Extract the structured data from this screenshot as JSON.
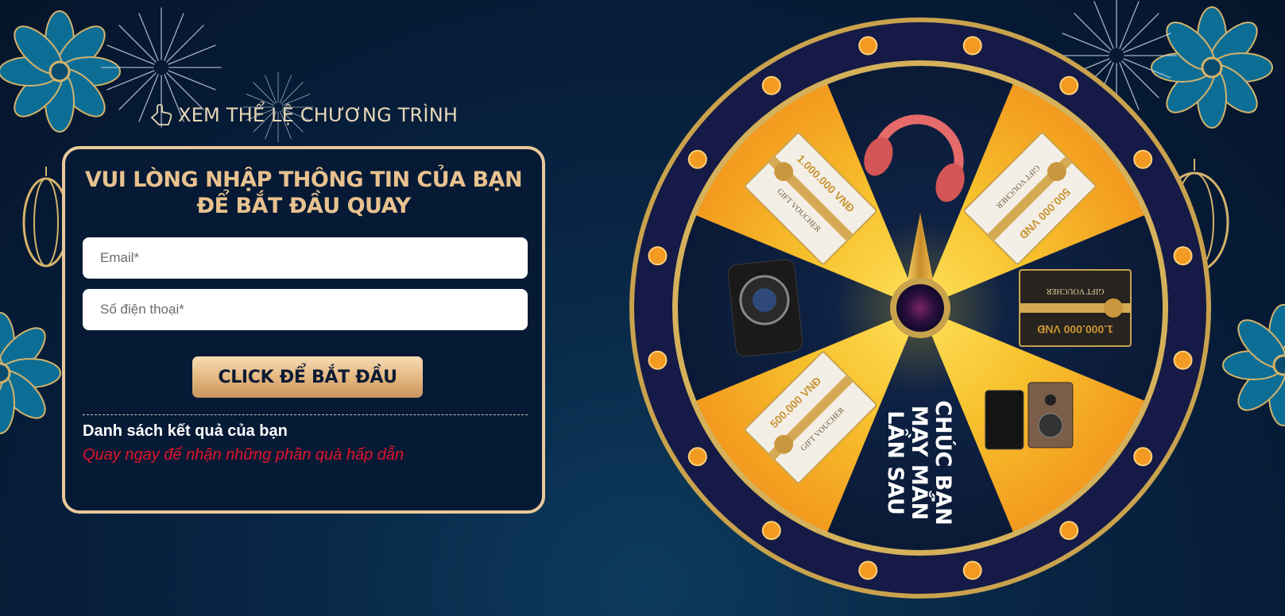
{
  "rules_link": {
    "label": "XEM THỂ LỆ CHƯƠNG TRÌNH",
    "icon": "pointer-hand-icon"
  },
  "form": {
    "title": "VUI LÒNG NHẬP THÔNG TIN CỦA BẠN ĐỂ BẮT ĐẦU QUAY",
    "email_placeholder": "Email*",
    "phone_placeholder": "Số điện thoại*",
    "start_button": "CLICK ĐỂ BẮT ĐẦU",
    "results_title": "Danh sách kết quả của bạn",
    "results_empty": "Quay ngay để nhận những phần quà hấp dẫn"
  },
  "wheel": {
    "segments": [
      {
        "prize": "gift-voucher-icon",
        "label": "500.000 VNĐ",
        "theme": "gold"
      },
      {
        "prize": "gift-voucher-icon",
        "label": "1.000.000 VNĐ",
        "theme": "dark"
      },
      {
        "prize": "speakers-icon",
        "label": "",
        "theme": "gold"
      },
      {
        "prize": "text",
        "label": "CHÚC BẠN MAY MẮN LẦN SAU",
        "theme": "dark"
      },
      {
        "prize": "gift-voucher-icon",
        "label": "500.000 VNĐ",
        "theme": "gold"
      },
      {
        "prize": "camera-icon",
        "label": "",
        "theme": "dark"
      },
      {
        "prize": "gift-voucher-icon",
        "label": "1.000.000 VNĐ",
        "theme": "gold"
      },
      {
        "prize": "headphones-icon",
        "label": "",
        "theme": "dark"
      }
    ],
    "voucher_caption": "GIFT VOUCHER",
    "colors": {
      "gold": "#f5ad22",
      "dark": "#0a1c3a",
      "rim": "#d7b25e",
      "bulb": "#f29a21"
    }
  }
}
